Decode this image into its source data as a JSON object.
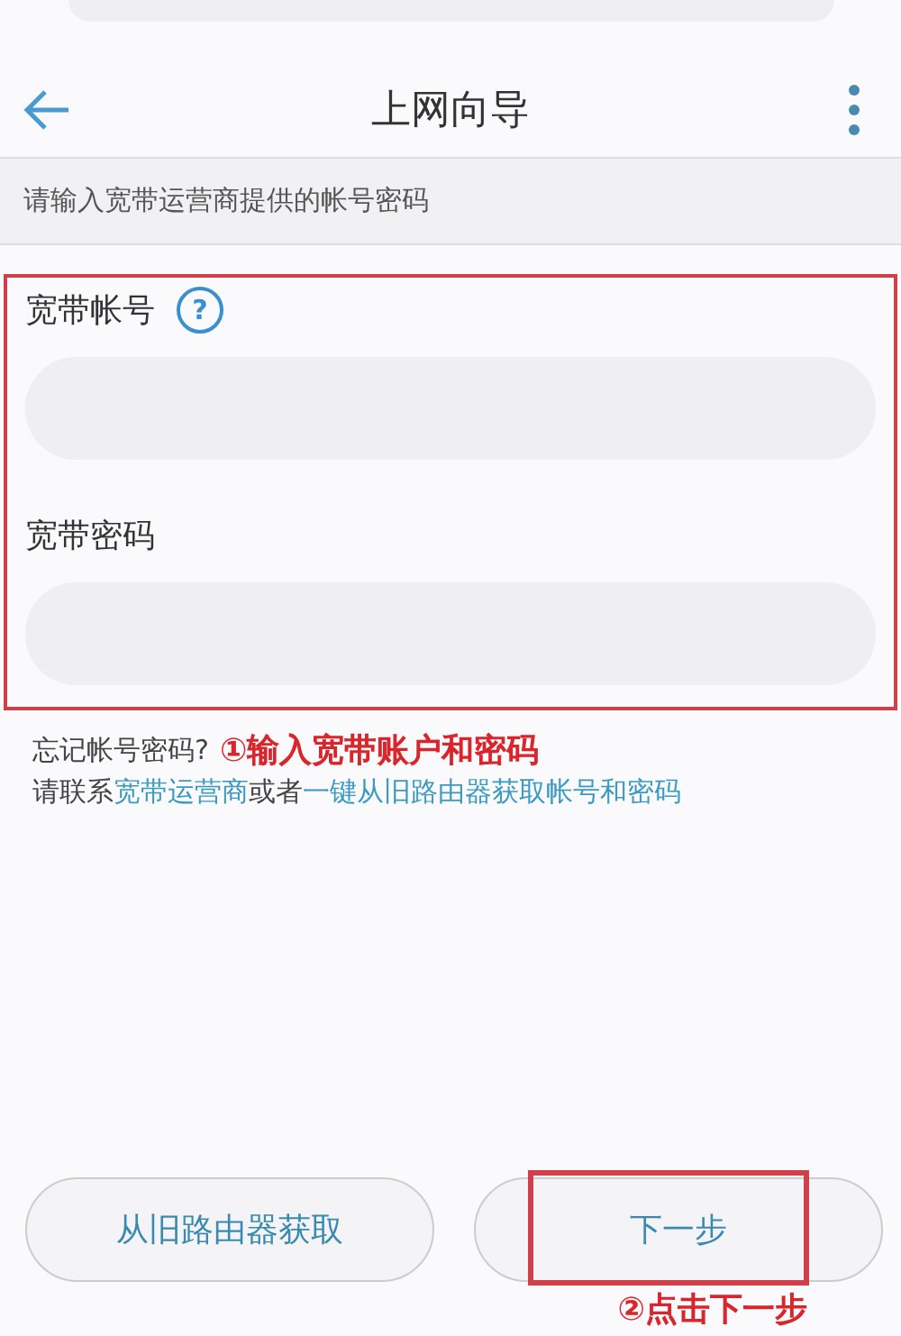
{
  "header": {
    "title": "上网向导"
  },
  "hint": "请输入宽带运营商提供的帐号密码",
  "fields": [
    {
      "label": "宽带帐号",
      "help": "?"
    },
    {
      "label": "宽带密码"
    }
  ],
  "forgot": {
    "title": "忘记帐号密码?",
    "prefix": "请联系",
    "link_1": "宽带运营商",
    "middle": "或者",
    "link_2": "一键从旧路由器获取帐号和密码"
  },
  "annotations": [
    "①输入宽带账户和密码",
    "②点击下一步"
  ],
  "buttons": [
    {
      "label": "从旧路由器获取",
      "highlighted": false
    },
    {
      "label": "下一步",
      "highlighted": true
    }
  ]
}
